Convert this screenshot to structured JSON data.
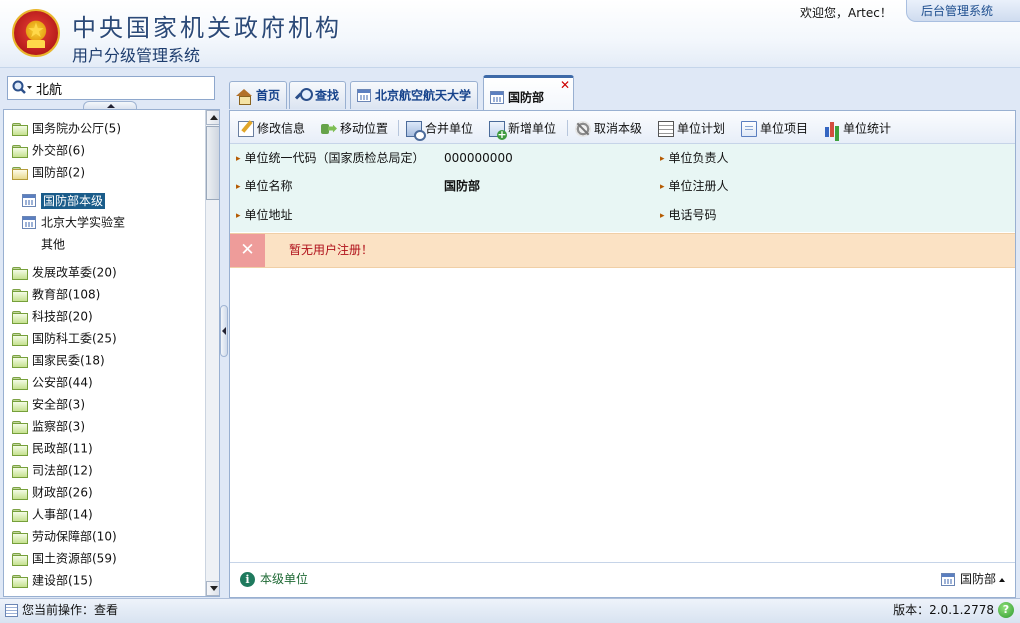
{
  "header": {
    "title": "中央国家机关政府机构",
    "subtitle": "用户分级管理系统",
    "welcome": "欢迎您，Artec！",
    "backend_link": "后台管理系统"
  },
  "search": {
    "value": "北航"
  },
  "tree": {
    "items": [
      {
        "label": "国务院办公厅(5)",
        "type": "folder"
      },
      {
        "label": "外交部(6)",
        "type": "folder"
      },
      {
        "label": "国防部(2)",
        "type": "folder-open"
      },
      {
        "label": "国防部本级",
        "type": "unit",
        "selected": true
      },
      {
        "label": "北京大学实验室",
        "type": "unit"
      },
      {
        "label": "其他",
        "type": "text"
      },
      {
        "label": "发展改革委(20)",
        "type": "folder"
      },
      {
        "label": "教育部(108)",
        "type": "folder"
      },
      {
        "label": "科技部(20)",
        "type": "folder"
      },
      {
        "label": "国防科工委(25)",
        "type": "folder"
      },
      {
        "label": "国家民委(18)",
        "type": "folder"
      },
      {
        "label": "公安部(44)",
        "type": "folder"
      },
      {
        "label": "安全部(3)",
        "type": "folder"
      },
      {
        "label": "监察部(3)",
        "type": "folder"
      },
      {
        "label": "民政部(11)",
        "type": "folder"
      },
      {
        "label": "司法部(12)",
        "type": "folder"
      },
      {
        "label": "财政部(26)",
        "type": "folder"
      },
      {
        "label": "人事部(14)",
        "type": "folder"
      },
      {
        "label": "劳动保障部(10)",
        "type": "folder"
      },
      {
        "label": "国土资源部(59)",
        "type": "folder"
      },
      {
        "label": "建设部(15)",
        "type": "folder"
      }
    ]
  },
  "tabs": [
    {
      "label": "首页",
      "icon": "home-icon"
    },
    {
      "label": "查找",
      "icon": "search-icon"
    },
    {
      "label": "北京航空航天大学",
      "icon": "calendar-icon"
    },
    {
      "label": "国防部",
      "icon": "calendar-icon",
      "active": true
    }
  ],
  "toolbar": {
    "edit": "修改信息",
    "move": "移动位置",
    "merge": "合并单位",
    "add": "新增单位",
    "cancel": "取消本级",
    "plan": "单位计划",
    "project": "单位项目",
    "stats": "单位统计"
  },
  "info": {
    "code_label": "单位统一代码（国家质检总局定）",
    "code_value": "000000000",
    "name_label": "单位名称",
    "name_value": "国防部",
    "address_label": "单位地址",
    "address_value": "",
    "leader_label": "单位负责人",
    "registrant_label": "单位注册人",
    "phone_label": "电话号码"
  },
  "alert": {
    "message": "暂无用户注册！"
  },
  "panel_footer": {
    "left": "本级单位",
    "right": "国防部"
  },
  "statusbar": {
    "operation": "您当前操作：查看",
    "version": "版本：2.0.1.2778"
  },
  "colors": {
    "accent": "#15428b",
    "info_bg": "#e8f6f4",
    "alert_bg": "#fbe2c4",
    "alert_text": "#b0101a",
    "selected_bg": "#1a5c8a"
  }
}
